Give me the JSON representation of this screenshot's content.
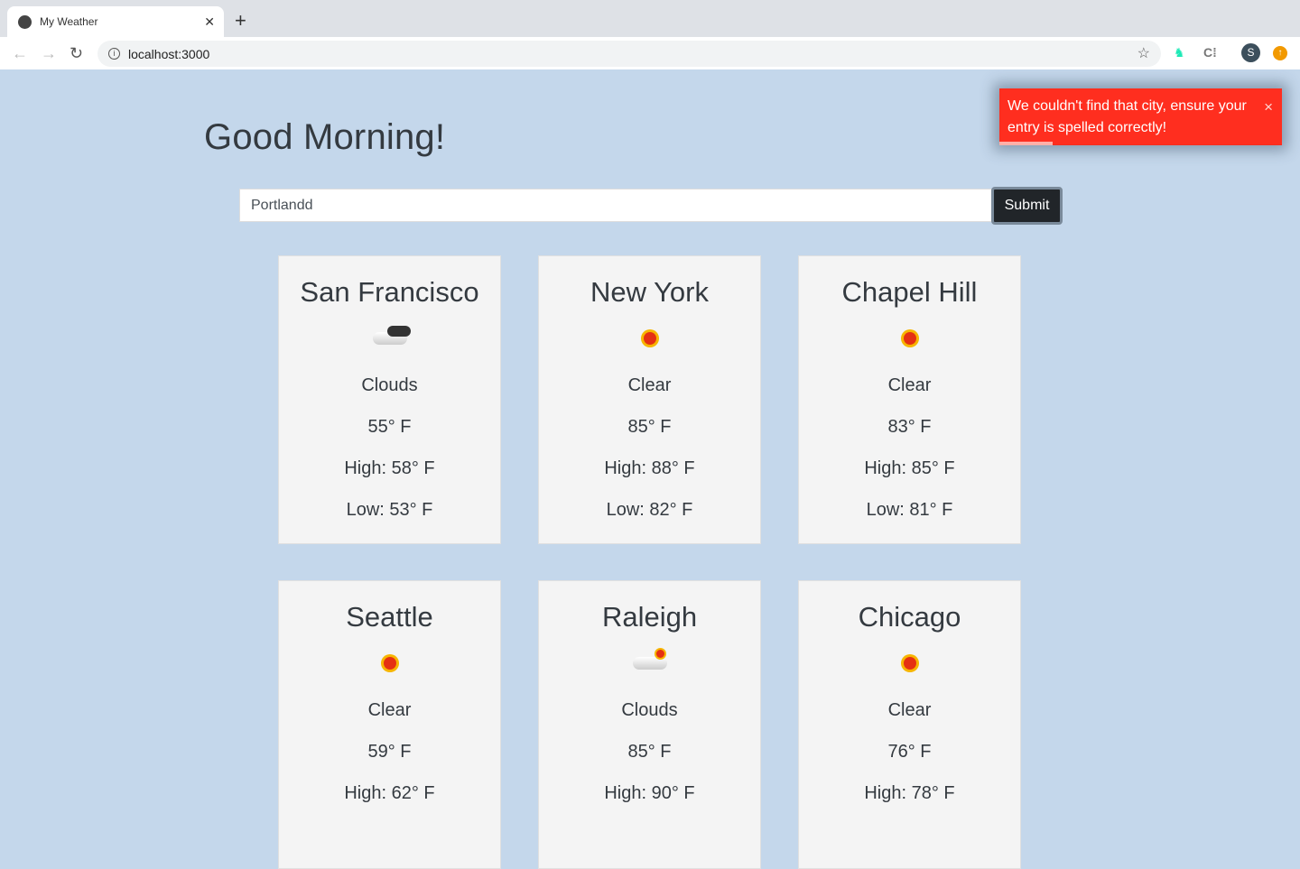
{
  "browser": {
    "tab_title": "My Weather",
    "url": "localhost:3000",
    "profile_initial": "S"
  },
  "page": {
    "greeting": "Good Morning!",
    "search_value": "Portlandd",
    "submit_label": "Submit"
  },
  "toast": {
    "message": "We couldn't find that city, ensure your entry is spelled correctly!",
    "close": "×",
    "progress_percent": 19,
    "color": "#ff2e1f"
  },
  "cards": [
    {
      "city": "San Francisco",
      "icon": "dark-cloud-icon",
      "condition": "Clouds",
      "temp": "55° F",
      "high": "High: 58° F",
      "low": "Low: 53° F"
    },
    {
      "city": "New York",
      "icon": "sun-icon",
      "condition": "Clear",
      "temp": "85° F",
      "high": "High: 88° F",
      "low": "Low: 82° F"
    },
    {
      "city": "Chapel Hill",
      "icon": "sun-icon",
      "condition": "Clear",
      "temp": "83° F",
      "high": "High: 85° F",
      "low": "Low: 81° F"
    },
    {
      "city": "Seattle",
      "icon": "sun-icon",
      "condition": "Clear",
      "temp": "59° F",
      "high": "High: 62° F",
      "low": ""
    },
    {
      "city": "Raleigh",
      "icon": "cloud-sun-icon",
      "condition": "Clouds",
      "temp": "85° F",
      "high": "High: 90° F",
      "low": ""
    },
    {
      "city": "Chicago",
      "icon": "sun-icon",
      "condition": "Clear",
      "temp": "76° F",
      "high": "High: 78° F",
      "low": ""
    }
  ]
}
